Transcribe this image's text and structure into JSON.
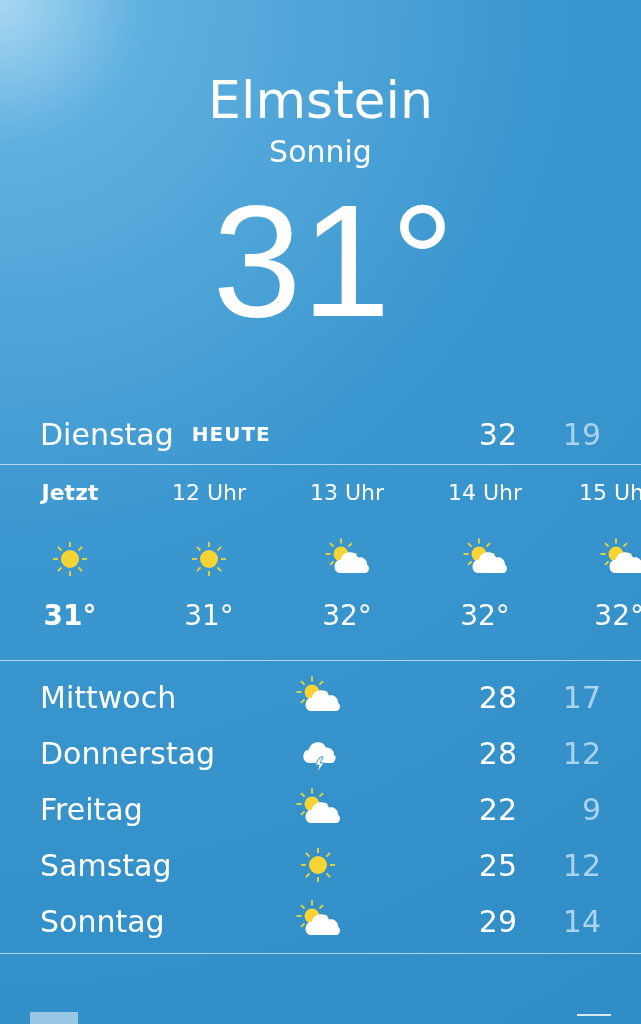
{
  "header": {
    "city": "Elmstein",
    "condition": "Sonnig",
    "temperature": "31°"
  },
  "today": {
    "day": "Dienstag",
    "label": "HEUTE",
    "high": "32",
    "low": "19"
  },
  "hourly": [
    {
      "time": "Jetzt",
      "kind": "sunny",
      "temp": "31°",
      "selected": true
    },
    {
      "time": "12 Uhr",
      "kind": "sunny",
      "temp": "31°",
      "selected": false
    },
    {
      "time": "13 Uhr",
      "kind": "partly-cloudy",
      "temp": "32°",
      "selected": false
    },
    {
      "time": "14 Uhr",
      "kind": "partly-cloudy",
      "temp": "32°",
      "selected": false
    },
    {
      "time": "15 Uh",
      "kind": "partly-cloudy",
      "temp": "32°",
      "selected": false
    }
  ],
  "daily": [
    {
      "day": "Mittwoch",
      "kind": "partly-cloudy",
      "high": "28",
      "low": "17"
    },
    {
      "day": "Donnerstag",
      "kind": "thunder",
      "high": "28",
      "low": "12"
    },
    {
      "day": "Freitag",
      "kind": "partly-cloudy",
      "high": "22",
      "low": "9"
    },
    {
      "day": "Samstag",
      "kind": "sunny",
      "high": "25",
      "low": "12"
    },
    {
      "day": "Sonntag",
      "kind": "partly-cloudy",
      "high": "29",
      "low": "14"
    }
  ]
}
